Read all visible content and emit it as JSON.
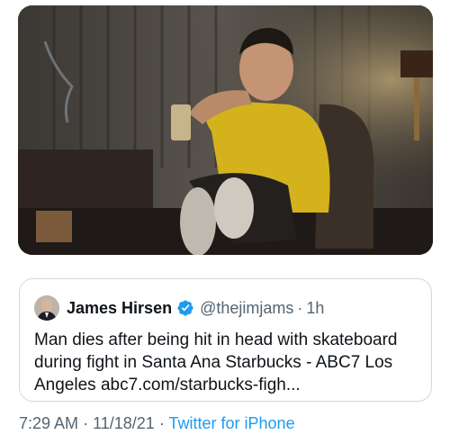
{
  "media": {
    "alt_icon": "photo-image"
  },
  "quoted_tweet": {
    "author": {
      "display_name": "James Hirsen",
      "handle": "@thejimjams",
      "verified_icon": "verified-badge-icon"
    },
    "separator": "·",
    "age": "1h",
    "text": "Man dies after being hit in head with skateboard during fight in Santa Ana Starbucks - ABC7 Los Angeles abc7.com/starbucks-figh..."
  },
  "tweet_meta": {
    "time": "7:29 AM",
    "dot1": "·",
    "date": "11/18/21",
    "dot2": "·",
    "source": "Twitter for iPhone"
  },
  "colors": {
    "accent": "#1d9bf0",
    "muted": "#536471",
    "border": "#cfd9de"
  }
}
